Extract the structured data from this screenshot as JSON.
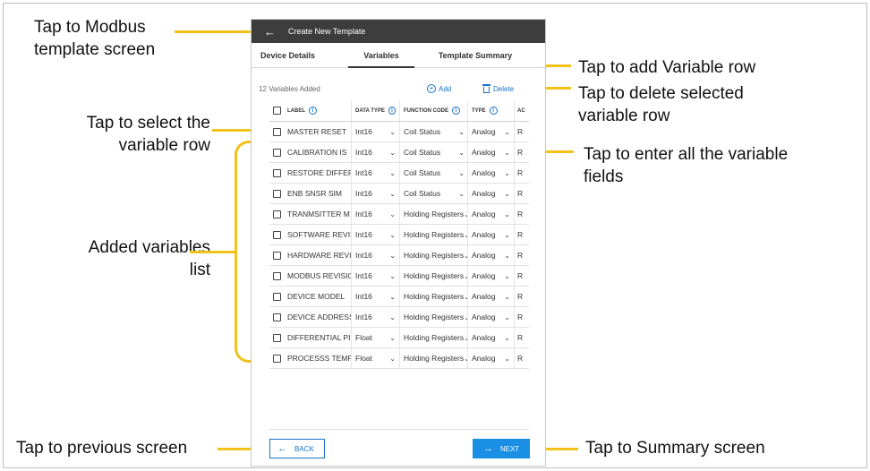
{
  "app": {
    "title": "Create New Template",
    "back_arrow": "←"
  },
  "tabs": [
    {
      "label": "Device Details",
      "active": false
    },
    {
      "label": "Variables",
      "active": true
    },
    {
      "label": "Template Summary",
      "active": false
    }
  ],
  "toolbar": {
    "count_text": "12 Variables Added",
    "add_label": "Add",
    "delete_label": "Delete"
  },
  "table": {
    "headers": [
      "LABEL",
      "DATA TYPE",
      "FUNCTION CODE",
      "TYPE",
      "AC"
    ],
    "rows": [
      {
        "label": "MASTER RESET",
        "data_type": "Int16",
        "function_code": "Coil Status",
        "type": "Analog",
        "access": "R"
      },
      {
        "label": "CALIBRATION IS",
        "data_type": "Int16",
        "function_code": "Coil Status",
        "type": "Analog",
        "access": "R"
      },
      {
        "label": "RESTORE DIFFEF",
        "data_type": "Int16",
        "function_code": "Coil Status",
        "type": "Analog",
        "access": "R"
      },
      {
        "label": "ENB SNSR SIM",
        "data_type": "Int16",
        "function_code": "Coil Status",
        "type": "Analog",
        "access": "R"
      },
      {
        "label": "TRANMSITTER M",
        "data_type": "Int16",
        "function_code": "Holding Registers",
        "type": "Analog",
        "access": "R"
      },
      {
        "label": "SOFTWARE REVIS",
        "data_type": "Int16",
        "function_code": "Holding Registers",
        "type": "Analog",
        "access": "R"
      },
      {
        "label": "HARDWARE REVI",
        "data_type": "Int16",
        "function_code": "Holding Registers",
        "type": "Analog",
        "access": "R"
      },
      {
        "label": "MODBUS REVISIO",
        "data_type": "Int16",
        "function_code": "Holding Registers",
        "type": "Analog",
        "access": "R"
      },
      {
        "label": "DEVICE MODEL",
        "data_type": "Int16",
        "function_code": "Holding Registers",
        "type": "Analog",
        "access": "R"
      },
      {
        "label": "DEVICE ADDRESS",
        "data_type": "Int16",
        "function_code": "Holding Registers",
        "type": "Analog",
        "access": "R"
      },
      {
        "label": "DIFFERENTIAL PI",
        "data_type": "Float",
        "function_code": "Holding Registers",
        "type": "Analog",
        "access": "R"
      },
      {
        "label": "PROCESSS TEMP",
        "data_type": "Float",
        "function_code": "Holding Registers",
        "type": "Analog",
        "access": "R"
      }
    ]
  },
  "footer": {
    "back_label": "BACK",
    "next_label": "NEXT"
  },
  "callouts": {
    "modbus_template": "Tap to Modbus\ntemplate screen",
    "select_row": "Tap to select the\nvariable row",
    "added_list": "Added variables\nlist",
    "previous": "Tap to previous screen",
    "add_row": "Tap to add Variable row",
    "delete_row": "Tap to delete selected\nvariable row",
    "enter_fields": "Tap to enter all the variable\nfields",
    "summary": "Tap to Summary screen"
  },
  "colors": {
    "callout_line": "#f2c21a",
    "app_bar": "#3d3d3d",
    "accent": "#1a73c8",
    "next_button": "#1a8fe3"
  }
}
